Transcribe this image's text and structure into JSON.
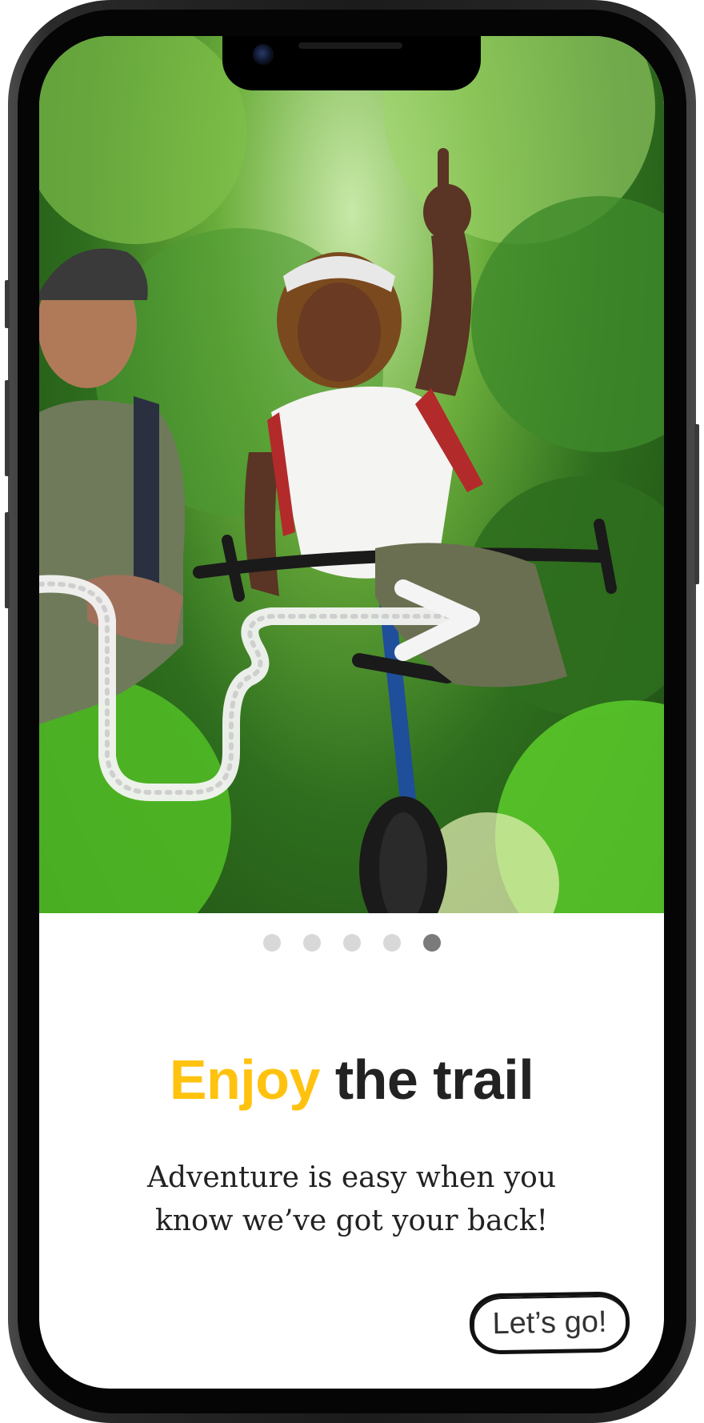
{
  "onboarding": {
    "page_count": 5,
    "active_page": 5,
    "title_accent": "Enjoy",
    "title_rest": "the trail",
    "subtitle": "Adventure is easy when you know we’ve got your back!",
    "cta_label": "Let’s go!"
  },
  "colors": {
    "accent": "#ffc20e",
    "text": "#222222",
    "dot_inactive": "#d8d8d8",
    "dot_active": "#7a7a7a"
  },
  "icons": {
    "hero_arrow": "hand-drawn-arrow-icon"
  }
}
